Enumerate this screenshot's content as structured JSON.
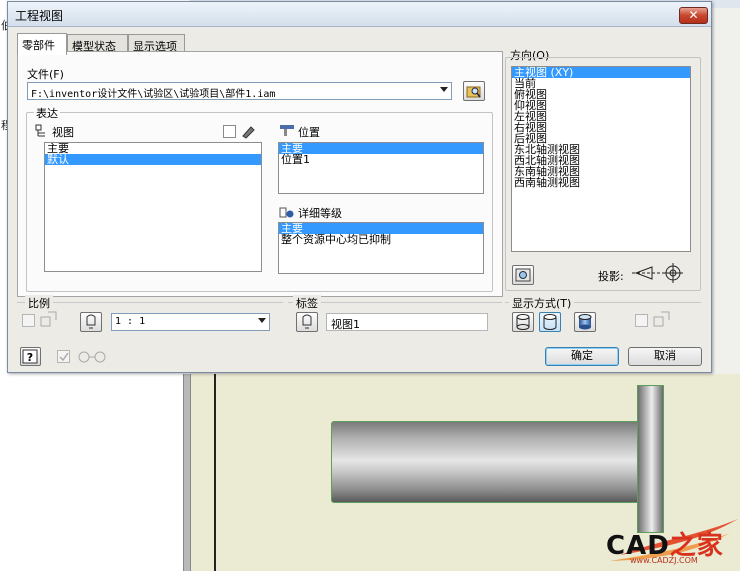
{
  "background": {
    "left_fragments": [
      "程",
      "伯"
    ]
  },
  "watermark": {
    "brand_prefix": "CAD",
    "brand_suffix": "之家",
    "url": "www.CADZJ.COM"
  },
  "dialog": {
    "title": "工程视图",
    "close_glyph": "✕",
    "tabs": [
      {
        "label": "零部件",
        "active": true
      },
      {
        "label": "模型状态",
        "active": false
      },
      {
        "label": "显示选项",
        "active": false
      }
    ],
    "file": {
      "label": "文件(F)",
      "value": "F:\\inventor设计文件\\试验区\\试验项目\\部件1.iam"
    },
    "representation": {
      "group_label": "表达",
      "view": {
        "label": "视图",
        "items": [
          {
            "label": "主要",
            "selected": false
          },
          {
            "label": "默认",
            "selected": true
          }
        ]
      },
      "position": {
        "label": "位置",
        "items": [
          {
            "label": "主要",
            "selected": true
          },
          {
            "label": "位置1",
            "selected": false
          }
        ]
      },
      "level_of_detail": {
        "label": "详细等级",
        "items": [
          {
            "label": "主要",
            "selected": true
          },
          {
            "label": "整个资源中心均已抑制",
            "selected": false
          }
        ]
      }
    },
    "orientation": {
      "label": "方向(O)",
      "items": [
        {
          "label": "主视图 (XY)",
          "selected": true
        },
        {
          "label": "当前",
          "selected": false
        },
        {
          "label": "俯视图",
          "selected": false
        },
        {
          "label": "仰视图",
          "selected": false
        },
        {
          "label": "左视图",
          "selected": false
        },
        {
          "label": "右视图",
          "selected": false
        },
        {
          "label": "后视图",
          "selected": false
        },
        {
          "label": "东北轴测视图",
          "selected": false
        },
        {
          "label": "西北轴测视图",
          "selected": false
        },
        {
          "label": "东南轴测视图",
          "selected": false
        },
        {
          "label": "西南轴测视图",
          "selected": false
        }
      ],
      "projection_label": "投影:"
    },
    "scale": {
      "label": "比例",
      "value": "1 : 1"
    },
    "view_label": {
      "label": "标签",
      "value": "视图1"
    },
    "display_style": {
      "label": "显示方式(T)"
    },
    "buttons": {
      "ok": "确定",
      "cancel": "取消"
    },
    "colors": {
      "selection": "#3399ff",
      "titlebar": "#d3dfec"
    }
  }
}
